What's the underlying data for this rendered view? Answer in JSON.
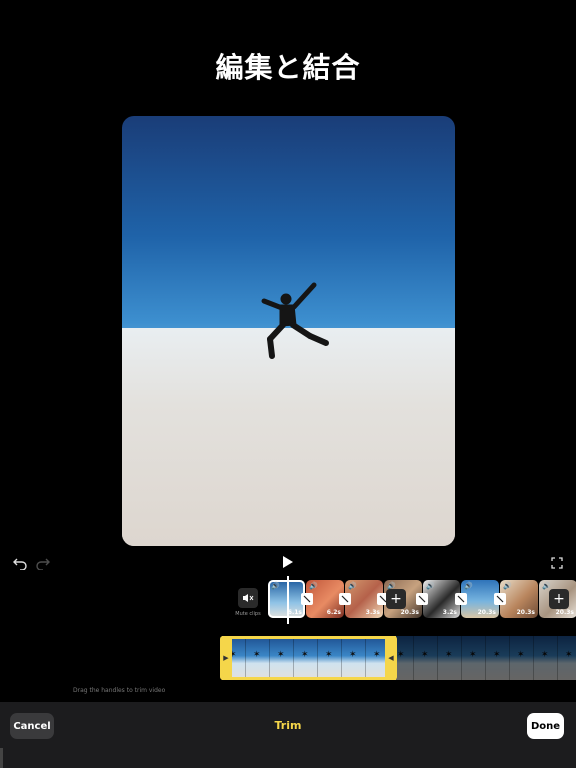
{
  "header": {
    "title": "編集と結合"
  },
  "controls": {
    "undo_icon": "undo-icon",
    "redo_icon": "redo-icon",
    "play_icon": "play-icon",
    "fullscreen_icon": "fullscreen-icon"
  },
  "timeline": {
    "mute_label": "Mute clips",
    "clips": [
      {
        "duration": "6.1s",
        "selected": true
      },
      {
        "duration": "6.2s"
      },
      {
        "duration": "3.3s"
      },
      {
        "duration": "20.3s"
      },
      {
        "duration": "3.2s"
      },
      {
        "duration": "20.3s"
      },
      {
        "duration": "20.3s"
      },
      {
        "duration": "20.3s"
      }
    ],
    "add_label": "+"
  },
  "trim": {
    "hint": "Drag the handles to trim video",
    "handle_color": "#f5d64a"
  },
  "bottom_bar": {
    "cancel_label": "Cancel",
    "title": "Trim",
    "done_label": "Done"
  }
}
